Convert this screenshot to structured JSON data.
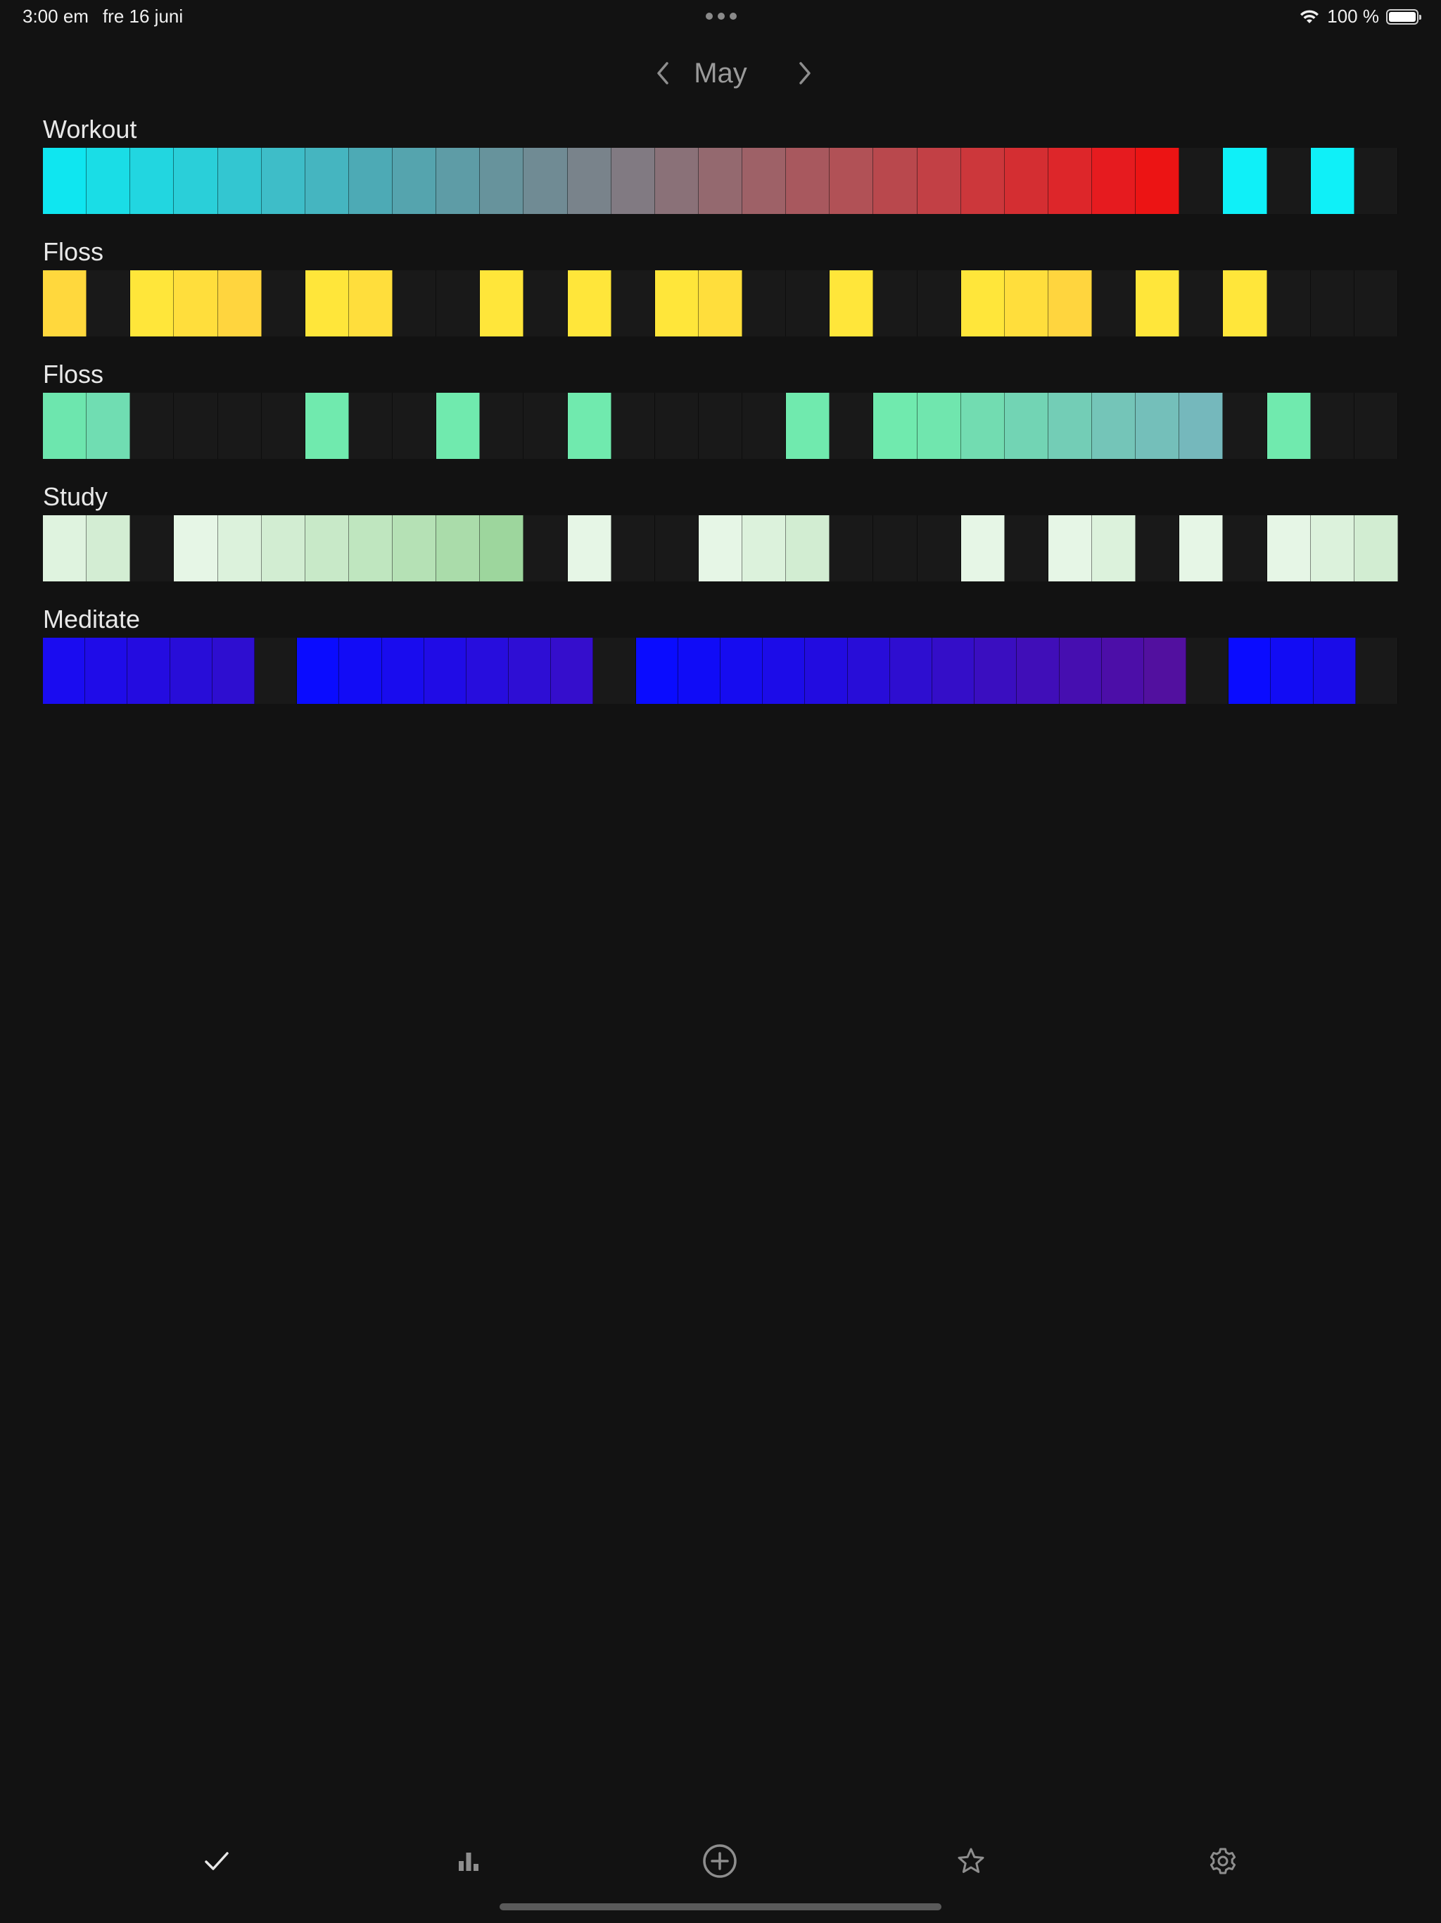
{
  "status_bar": {
    "time": "3:00 em",
    "date": "fre 16 juni",
    "battery": "100 %"
  },
  "header": {
    "month": "May",
    "prev_icon": "chevron-left-icon",
    "next_icon": "chevron-right-icon"
  },
  "habits": [
    {
      "name": "Workout",
      "cells": [
        "#0fe6f0",
        "#1adde6",
        "#22d6e0",
        "#2acfd9",
        "#33c6d1",
        "#3ebdc8",
        "#45b5c0",
        "#4daab5",
        "#55a4ae",
        "#5e9ca6",
        "#67939c",
        "#708b94",
        "#79838b",
        "#817a82",
        "#8a7178",
        "#94696f",
        "#9e6167",
        "#a8585e",
        "#b15156",
        "#b9484d",
        "#c24045",
        "#cc373b",
        "#d42e32",
        "#dd262a",
        "#e61b1f",
        "#ec1414",
        "empty",
        "#0ff0f8",
        "empty",
        "#0ff0f8",
        "empty"
      ],
      "empty_color": "#191919"
    },
    {
      "name": "Floss",
      "cells": [
        "#ffd83d",
        "empty",
        "#ffe63a",
        "#ffde3c",
        "#ffd53e",
        "empty",
        "#ffe63a",
        "#ffde3c",
        "empty",
        "empty",
        "#ffe63a",
        "empty",
        "#ffe63a",
        "empty",
        "#ffe63a",
        "#ffde3c",
        "empty",
        "empty",
        "#ffe63a",
        "empty",
        "empty",
        "#ffe63a",
        "#ffde3c",
        "#ffd53e",
        "empty",
        "#ffe63a",
        "empty",
        "#ffe63a",
        "empty",
        "empty",
        "empty"
      ],
      "empty_color": "#191919"
    },
    {
      "name": "Floss",
      "cells": [
        "#6de6ae",
        "#70ddb2",
        "empty",
        "empty",
        "empty",
        "empty",
        "#70eaae",
        "empty",
        "empty",
        "#70eaae",
        "empty",
        "empty",
        "#70eaae",
        "empty",
        "empty",
        "empty",
        "empty",
        "#70eaae",
        "empty",
        "#70eaae",
        "#70e6ae",
        "#72dcb1",
        "#72d4b4",
        "#73cdb6",
        "#74c5b8",
        "#74bfba",
        "#75b8bc",
        "empty",
        "#70eaae",
        "empty",
        "empty"
      ],
      "empty_color": "#191919"
    },
    {
      "name": "Study",
      "cells": [
        "#dff3df",
        "#d3edd3",
        "empty",
        "#e6f6e6",
        "#dcf2dc",
        "#d2edd2",
        "#c8e9c8",
        "#bfe6bf",
        "#b5e1b5",
        "#aadcaa",
        "#9dd69d",
        "empty",
        "#e6f6e6",
        "empty",
        "empty",
        "#e6f6e6",
        "#dcf2dc",
        "#d2edd2",
        "empty",
        "empty",
        "empty",
        "#e6f6e6",
        "empty",
        "#e6f6e6",
        "#dcf2dc",
        "empty",
        "#e6f6e6",
        "empty",
        "#e6f6e6",
        "#dcf2dc",
        "#d2edd2"
      ],
      "empty_color": "#191919"
    },
    {
      "name": "Meditate",
      "cells": [
        "#1a0cf0",
        "#1f0ce8",
        "#240ce0",
        "#280dd8",
        "#2e0ed0",
        "empty",
        "#0a0cff",
        "#120cf6",
        "#190cee",
        "#200ce6",
        "#270ddd",
        "#2e0ed4",
        "#350ecc",
        "empty",
        "#0a0cff",
        "#100cf7",
        "#160cf0",
        "#1c0ce8",
        "#220ce0",
        "#280dd8",
        "#2e0ed0",
        "#340ec8",
        "#3a0ec0",
        "#400eb8",
        "#460eb0",
        "#4c0ea8",
        "#52109f",
        "empty",
        "#0a0cff",
        "#120cf4",
        "#1a0ce8",
        "empty"
      ],
      "empty_color": "#191919"
    }
  ],
  "tab_bar": {
    "tabs": [
      {
        "icon": "checkmark-icon",
        "active": true
      },
      {
        "icon": "bar-chart-icon",
        "active": false
      },
      {
        "icon": "add-circle-icon",
        "active": false
      },
      {
        "icon": "star-icon",
        "active": false
      },
      {
        "icon": "gear-icon",
        "active": false
      }
    ]
  }
}
